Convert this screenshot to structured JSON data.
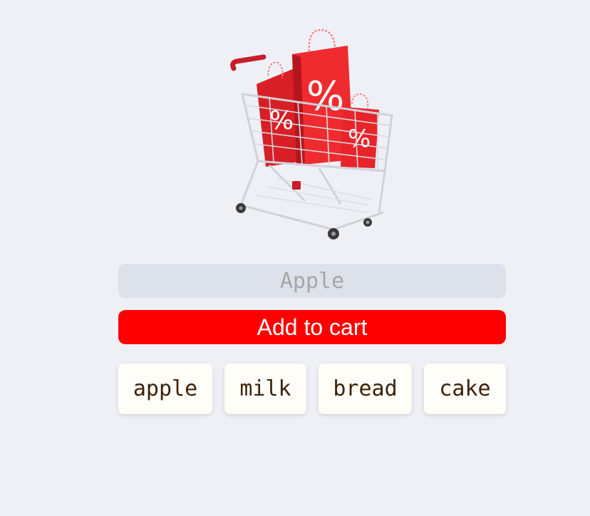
{
  "illustration": {
    "icon": "shopping-cart-with-sale-bags-icon",
    "bag_symbol": "%",
    "colors": {
      "bag": "#e8232a",
      "cart_frame": "#d9dbe0",
      "handle": "#c81e2b"
    }
  },
  "form": {
    "input_value": "",
    "input_placeholder": "Apple",
    "add_label": "Add to cart",
    "add_color": "#ff0000"
  },
  "suggestions": [
    "apple",
    "milk",
    "bread",
    "cake"
  ]
}
